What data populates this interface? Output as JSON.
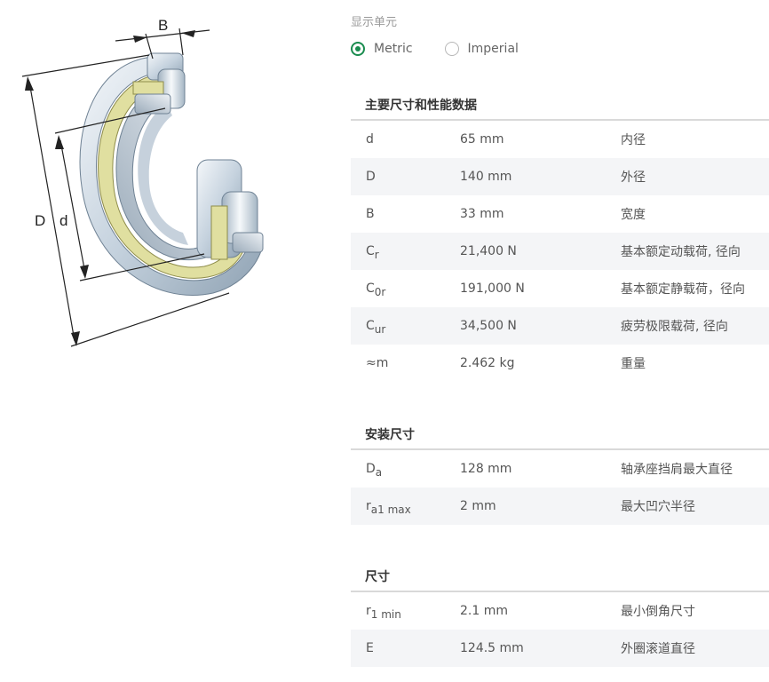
{
  "display_unit": {
    "label": "显示单元",
    "options": [
      {
        "label": "Metric",
        "selected": true
      },
      {
        "label": "Imperial",
        "selected": false
      }
    ]
  },
  "figure": {
    "label_B": "B",
    "label_D": "D",
    "label_d": "d"
  },
  "sections": [
    {
      "title": "主要尺寸和性能数据",
      "rows": [
        {
          "sym": "d",
          "sub": "",
          "value": "65 mm",
          "desc": "内径"
        },
        {
          "sym": "D",
          "sub": "",
          "value": "140 mm",
          "desc": "外径"
        },
        {
          "sym": "B",
          "sub": "",
          "value": "33 mm",
          "desc": "宽度"
        },
        {
          "sym": "C",
          "sub": "r",
          "value": "21,400 N",
          "desc": "基本额定动载荷, 径向"
        },
        {
          "sym": "C",
          "sub": "0r",
          "value": "191,000 N",
          "desc": "基本额定静载荷，径向"
        },
        {
          "sym": "C",
          "sub": "ur",
          "value": "34,500 N",
          "desc": "疲劳极限载荷, 径向"
        },
        {
          "sym": "≈m",
          "sub": "",
          "value": "2.462 kg",
          "desc": "重量"
        }
      ]
    },
    {
      "title": "安装尺寸",
      "rows": [
        {
          "sym": "D",
          "sub": "a",
          "value": "128 mm",
          "desc": "轴承座挡肩最大直径"
        },
        {
          "sym": "r",
          "sub": "a1 max",
          "value": "2 mm",
          "desc": "最大凹穴半径"
        }
      ]
    },
    {
      "title": "尺寸",
      "rows": [
        {
          "sym": "r",
          "sub": "1 min",
          "value": "2.1 mm",
          "desc": "最小倒角尺寸"
        },
        {
          "sym": "E",
          "sub": "",
          "value": "124.5 mm",
          "desc": "外圈滚道直径"
        }
      ]
    }
  ],
  "colors": {
    "accent": "#1a8c4f",
    "cage": "#e0dfa0",
    "steel": "#c9d6e2"
  }
}
